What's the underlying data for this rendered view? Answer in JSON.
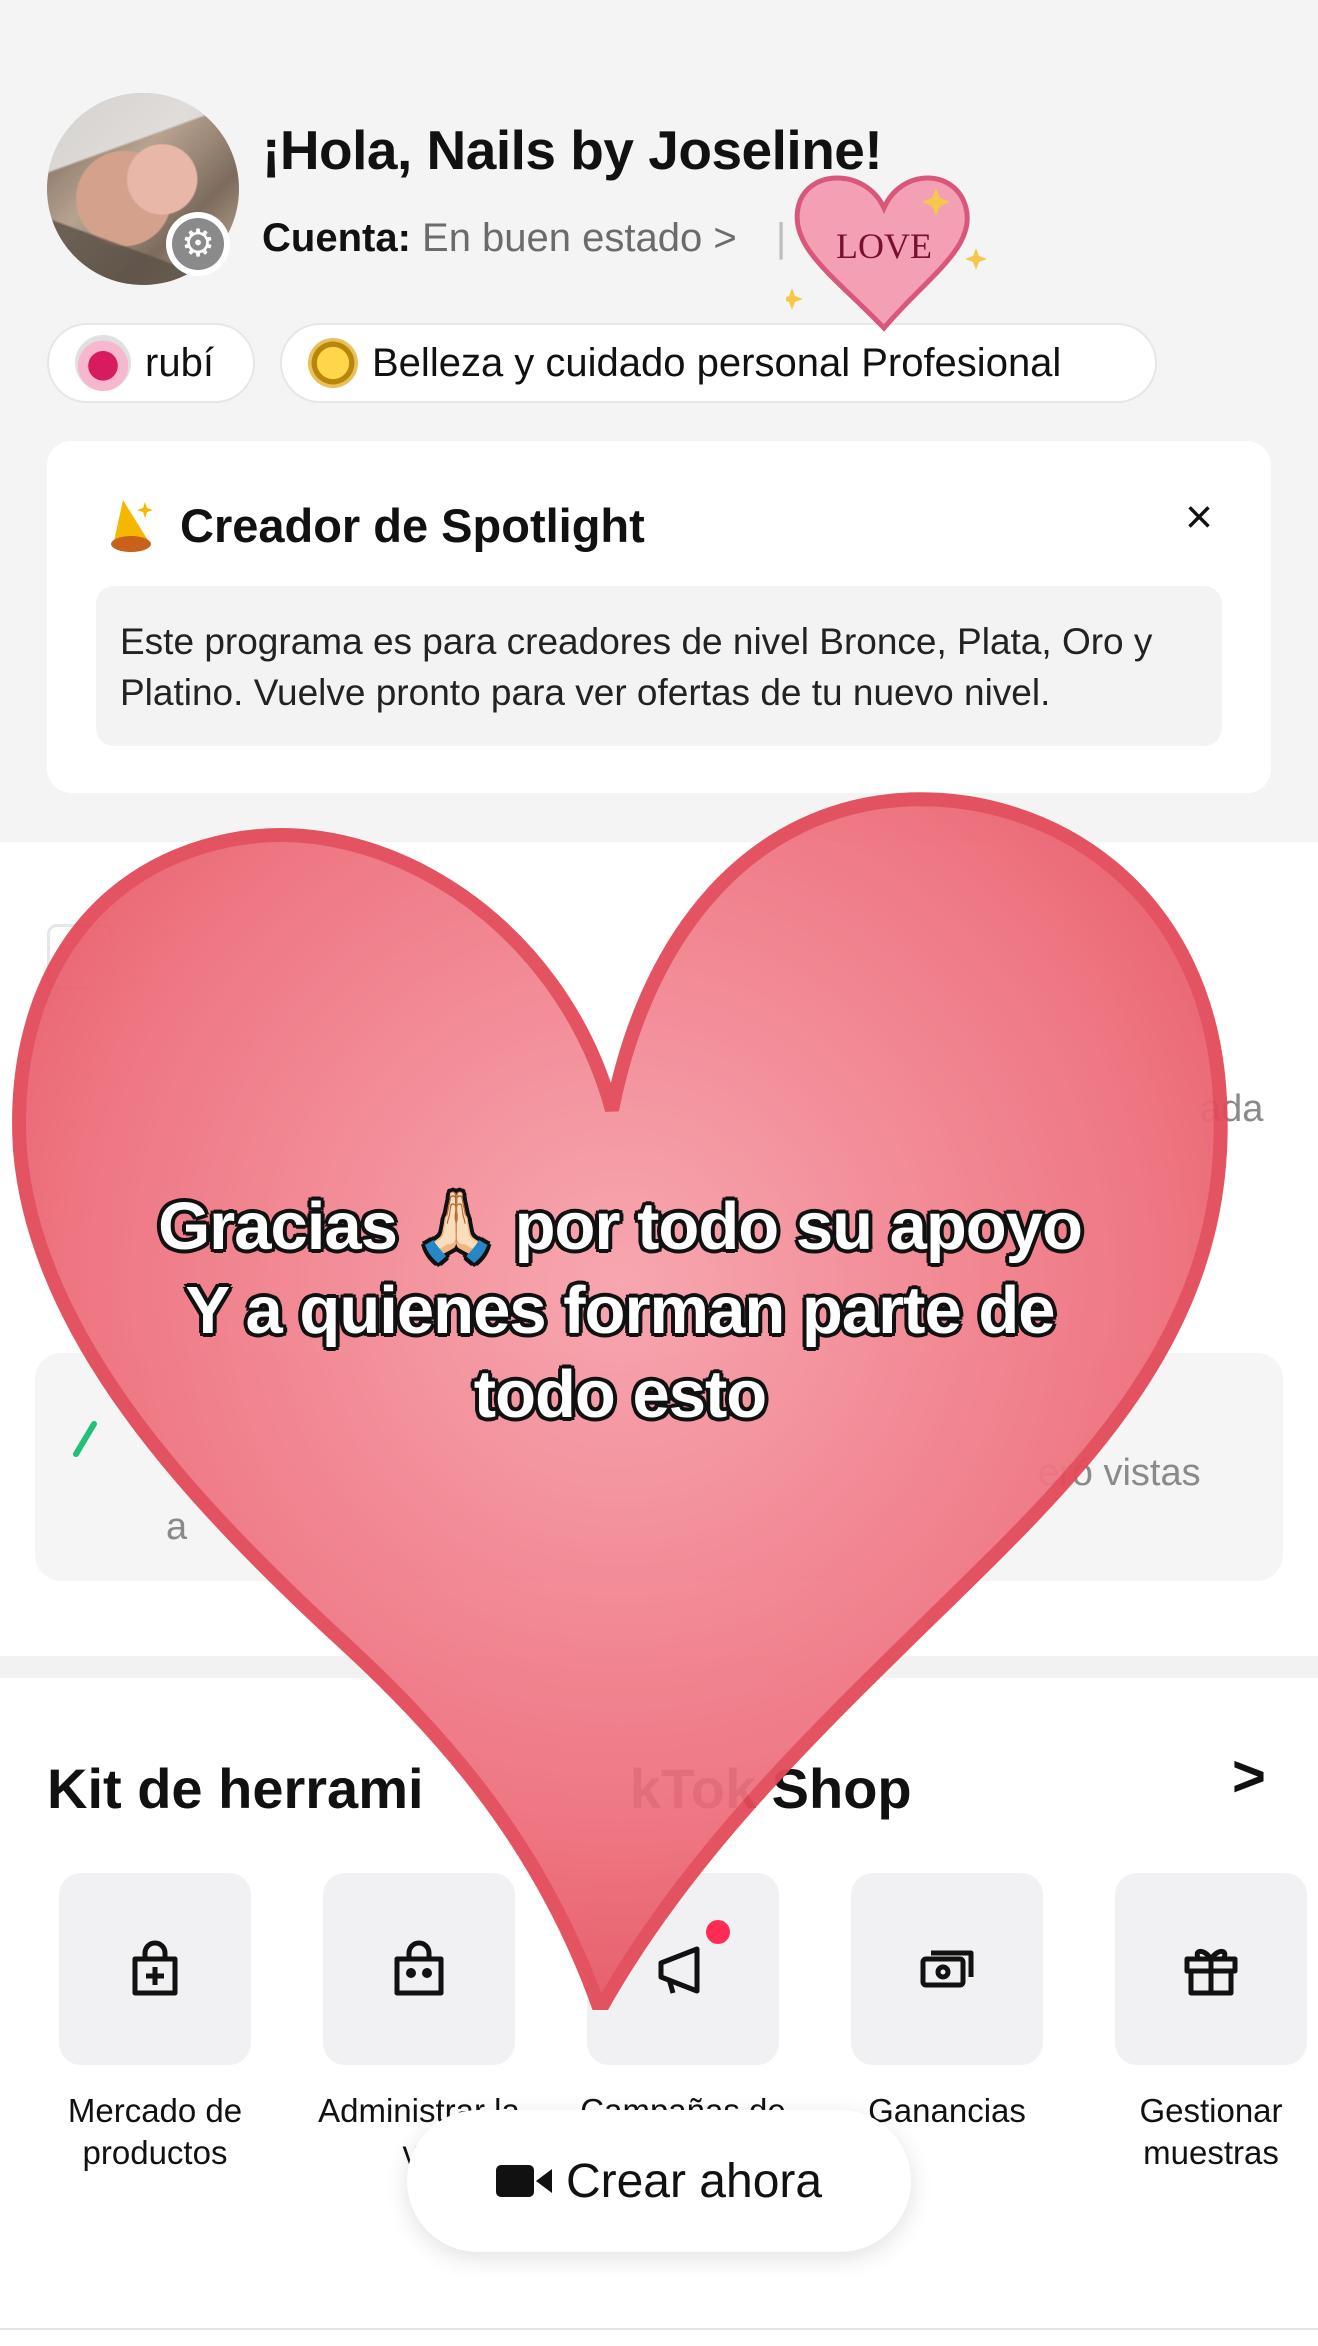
{
  "profile": {
    "greeting": "¡Hola, Nails by Joseline!",
    "account_label": "Cuenta:",
    "account_status": "En buen estado",
    "chevron": ">",
    "separator": "|"
  },
  "badges": {
    "tier": "rubí",
    "category": "Belleza y cuidado personal Profesional"
  },
  "spotlight": {
    "title": "Creador de Spotlight",
    "close": "×",
    "body": "Este programa es para creadores de nivel Bronce, Plata, Oro y Platino. Vuelve pronto para ver ofertas de tu nuevo nivel."
  },
  "partial_text": {
    "ada": "ada",
    "vistas": "eró vistas",
    "a": "a"
  },
  "kit": {
    "title": "Kit de herrami",
    "title_end": "kTok Shop",
    "arrow": ">",
    "tools": [
      {
        "label_line1": "Mercado de",
        "label_line2": "productos",
        "icon": "bag-plus-icon"
      },
      {
        "label_line1": "Administrar la",
        "label_line2": "vit",
        "icon": "shop-bag-icon"
      },
      {
        "label_line1": "Campañas de",
        "label_line2": "",
        "icon": "megaphone-icon"
      },
      {
        "label_line1": "Ganancias",
        "label_line2": "",
        "icon": "money-icon"
      },
      {
        "label_line1": "Gestionar",
        "label_line2": "muestras",
        "icon": "gift-icon"
      }
    ]
  },
  "cta": {
    "label": "Crear ahora"
  },
  "overlay": {
    "line1": "Gracias 🙏🏻 por todo su apoyo",
    "line2": "Y a quienes forman parte de",
    "line3": "todo esto",
    "sticker_text": "LOVE"
  },
  "colors": {
    "accent_red": "#fe2c55",
    "heart": "#e85a6a",
    "card_bg": "#ffffff",
    "page_bg": "#f4f4f5"
  }
}
